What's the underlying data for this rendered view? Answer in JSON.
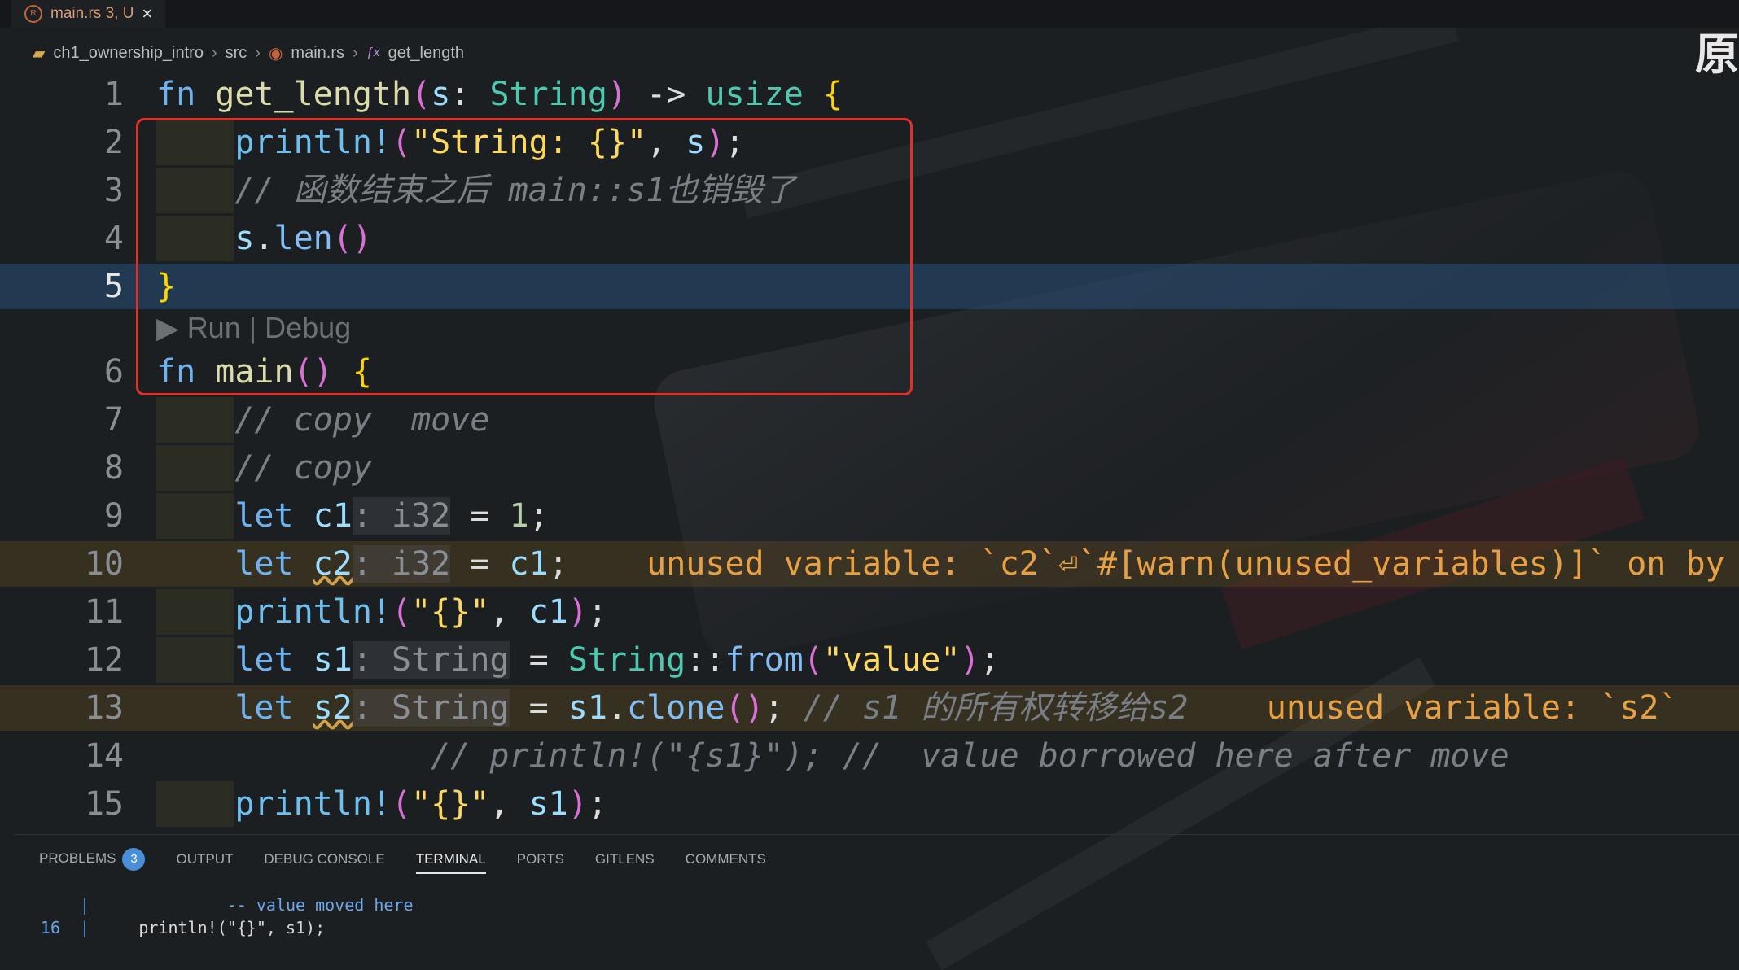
{
  "tab": {
    "label": "main.rs 3, U"
  },
  "breadcrumb": {
    "project": "ch1_ownership_intro",
    "folder": "src",
    "file": "main.rs",
    "symbol": "get_length"
  },
  "corner_char": "原",
  "codelens": "▶ Run | Debug",
  "lines": {
    "n1": "1",
    "n2": "2",
    "n3": "3",
    "n4": "4",
    "n5": "5",
    "n6": "6",
    "n7": "7",
    "n8": "8",
    "n9": "9",
    "n10": "10",
    "n11": "11",
    "n12": "12",
    "n13": "13",
    "n14": "14",
    "n15": "15"
  },
  "code": {
    "l1": {
      "kw": "fn",
      "name": "get_length",
      "param": "s",
      "ptype": "String",
      "arrow": "->",
      "ret": "usize"
    },
    "l2": {
      "macro": "println!",
      "str": "\"String: {}\"",
      "arg": "s"
    },
    "l3": {
      "comment": "// 函数结束之后 main::s1也销毁了"
    },
    "l4": {
      "obj": "s",
      "method": "len"
    },
    "l6": {
      "kw": "fn",
      "name": "main"
    },
    "l7": {
      "comment": "// copy  move"
    },
    "l8": {
      "comment": "// copy"
    },
    "l9": {
      "kw": "let",
      "var": "c1",
      "hint": ": i32",
      "num": "1"
    },
    "l10": {
      "kw": "let",
      "var": "c2",
      "hint": ": i32",
      "rhs": "c1",
      "warn": "unused variable: `c2`⏎`#[warn(unused_variables)]` on by"
    },
    "l11": {
      "macro": "println!",
      "str": "\"{}\"",
      "arg": "c1"
    },
    "l12": {
      "kw": "let",
      "var": "s1",
      "hint": ": String",
      "ty": "String",
      "fn": "from",
      "str": "\"value\""
    },
    "l13": {
      "kw": "let",
      "var": "s2",
      "hint": ": String",
      "obj": "s1",
      "method": "clone",
      "comment": "// s1 的所有权转移给s2",
      "warn": "unused variable: `s2`"
    },
    "l14": {
      "comment": "// println!(\"{s1}\"); //  value borrowed here after move"
    },
    "l15": {
      "macro": "println!",
      "str": "\"{}\"",
      "arg": "s1"
    }
  },
  "panel_tabs": {
    "problems": "PROBLEMS",
    "problems_count": "3",
    "output": "OUTPUT",
    "debug_console": "DEBUG CONSOLE",
    "terminal": "TERMINAL",
    "ports": "PORTS",
    "gitlens": "GITLENS",
    "comments": "COMMENTS"
  },
  "terminal": {
    "pipe": "|",
    "note": "-- value moved here",
    "line_no": "16",
    "line_code": "println!(\"{}\", s1);"
  }
}
